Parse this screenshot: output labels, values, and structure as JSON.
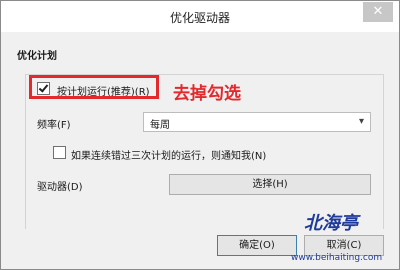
{
  "window": {
    "title": "优化驱动器",
    "close_glyph": "✕"
  },
  "section": {
    "title": "优化计划"
  },
  "schedule": {
    "checkbox_label": "按计划运行(推荐)(R)",
    "checked": true
  },
  "annotation": {
    "text": "去掉勾选"
  },
  "frequency": {
    "label": "频率(F)",
    "value": "每周"
  },
  "notify": {
    "label": "如果连续错过三次计划的运行，则通知我(N)",
    "checked": false
  },
  "drives": {
    "label": "驱动器(D)",
    "button_label": "选择(H)"
  },
  "footer": {
    "ok_label": "确定(O)",
    "cancel_label": "取消(C)"
  },
  "watermark": {
    "text": "北海亭",
    "url": "www.beihaiting.com"
  },
  "colors": {
    "accent_red": "#e3292c",
    "watermark_blue": "#1e3a9a"
  }
}
